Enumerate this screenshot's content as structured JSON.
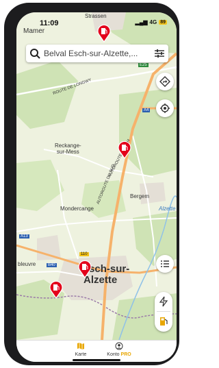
{
  "status": {
    "time": "11:09",
    "network": "4G",
    "battery": "89"
  },
  "search": {
    "placeholder": "Belval Esch-sur-Alzette,..."
  },
  "map": {
    "places": {
      "mamer": "Mamer",
      "strassen": "Strassen",
      "reckange": "Reckange-\nsur-Mess",
      "mondercange": "Mondercange",
      "bergem": "Bergem",
      "esch_line1": "Esch-sur-",
      "esch_line2": "Alzette",
      "bleuvre": "bleuvre",
      "alzette_river": "Alzette"
    },
    "roads": {
      "route_de_longwy": "ROUTE DE LONGWY",
      "autoroute_du_sud": "AUTOROUTE DU SUD",
      "autoroute_de_esch": "AUTOROUTE D'ESCH"
    },
    "shields": {
      "e25": "E25",
      "a4": "A4",
      "a13": "A13",
      "b40": "B40",
      "n110": "110"
    }
  },
  "tabs": [
    {
      "label": "Karte",
      "active": true
    },
    {
      "label": "Konto",
      "suffix": "PRO",
      "active": false
    }
  ],
  "colors": {
    "accent": "#e8a600",
    "pin": "#e3001b",
    "map_bg": "#eef2df",
    "highway": "#f6b26b"
  }
}
